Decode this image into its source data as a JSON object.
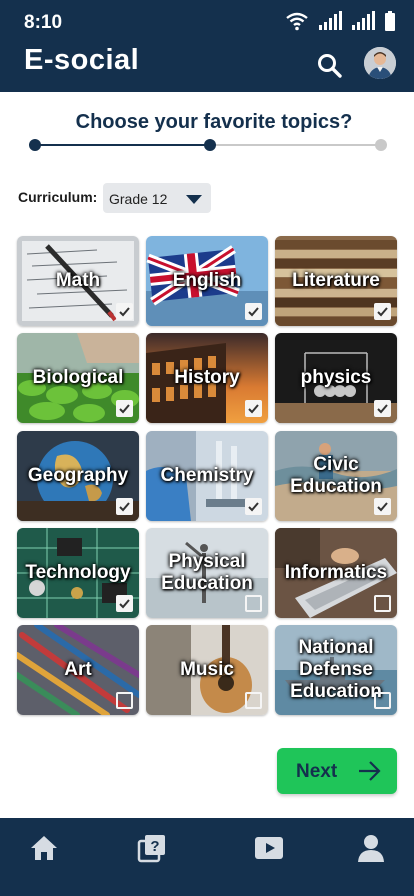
{
  "status_bar": {
    "time": "8:10"
  },
  "header": {
    "title": "E-social",
    "search_icon": "search-icon",
    "avatar": "user-avatar"
  },
  "page": {
    "title": "Choose your favorite topics?"
  },
  "stepper": {
    "total_steps": 3,
    "current_step": 2
  },
  "curriculum": {
    "label": "Curriculum:",
    "selected": "Grade 12"
  },
  "topics": [
    {
      "label": "Math",
      "checked": true
    },
    {
      "label": "English",
      "checked": true
    },
    {
      "label": "Literature",
      "checked": true
    },
    {
      "label": "Biological",
      "checked": true
    },
    {
      "label": "History",
      "checked": true
    },
    {
      "label": "physics",
      "checked": true
    },
    {
      "label": "Geography",
      "checked": true
    },
    {
      "label": "Chemistry",
      "checked": true
    },
    {
      "label": "Civic Education",
      "checked": true
    },
    {
      "label": "Technology",
      "checked": true
    },
    {
      "label": "Physical Education",
      "checked": false
    },
    {
      "label": "Informatics",
      "checked": false
    },
    {
      "label": "Art",
      "checked": false
    },
    {
      "label": "Music",
      "checked": false
    },
    {
      "label": "National Defense Education",
      "checked": false
    }
  ],
  "next_button": {
    "label": "Next"
  },
  "bottom_nav": {
    "items": [
      "home-icon",
      "quiz-icon",
      "video-icon",
      "profile-icon"
    ]
  },
  "colors": {
    "primary": "#14304d",
    "accent": "#1fc559"
  }
}
